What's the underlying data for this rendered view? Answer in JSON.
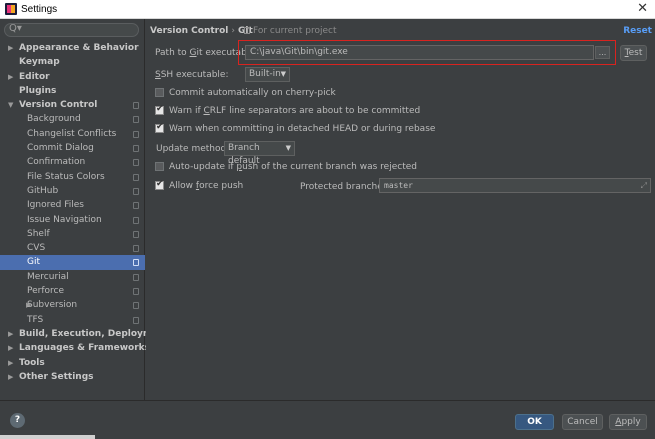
{
  "window": {
    "title": "Settings",
    "close_glyph": "✕"
  },
  "search": {
    "icon": "Q▾",
    "value": ""
  },
  "tree": [
    {
      "label": "Appearance & Behavior",
      "level": 0,
      "bold": true,
      "expander": "▶",
      "page_icon": false,
      "selected": false
    },
    {
      "label": "Keymap",
      "level": 0,
      "bold": true,
      "expander": "",
      "page_icon": false,
      "selected": false
    },
    {
      "label": "Editor",
      "level": 0,
      "bold": true,
      "expander": "▶",
      "page_icon": false,
      "selected": false
    },
    {
      "label": "Plugins",
      "level": 0,
      "bold": true,
      "expander": "",
      "page_icon": false,
      "selected": false
    },
    {
      "label": "Version Control",
      "level": 0,
      "bold": true,
      "expander": "▼",
      "page_icon": true,
      "selected": false
    },
    {
      "label": "Background",
      "level": 1,
      "bold": false,
      "expander": "",
      "page_icon": true,
      "selected": false
    },
    {
      "label": "Changelist Conflicts",
      "level": 1,
      "bold": false,
      "expander": "",
      "page_icon": true,
      "selected": false
    },
    {
      "label": "Commit Dialog",
      "level": 1,
      "bold": false,
      "expander": "",
      "page_icon": true,
      "selected": false
    },
    {
      "label": "Confirmation",
      "level": 1,
      "bold": false,
      "expander": "",
      "page_icon": true,
      "selected": false
    },
    {
      "label": "File Status Colors",
      "level": 1,
      "bold": false,
      "expander": "",
      "page_icon": true,
      "selected": false
    },
    {
      "label": "GitHub",
      "level": 1,
      "bold": false,
      "expander": "",
      "page_icon": true,
      "selected": false
    },
    {
      "label": "Ignored Files",
      "level": 1,
      "bold": false,
      "expander": "",
      "page_icon": true,
      "selected": false
    },
    {
      "label": "Issue Navigation",
      "level": 1,
      "bold": false,
      "expander": "",
      "page_icon": true,
      "selected": false
    },
    {
      "label": "Shelf",
      "level": 1,
      "bold": false,
      "expander": "",
      "page_icon": true,
      "selected": false
    },
    {
      "label": "CVS",
      "level": 1,
      "bold": false,
      "expander": "",
      "page_icon": true,
      "selected": false
    },
    {
      "label": "Git",
      "level": 1,
      "bold": false,
      "expander": "",
      "page_icon": true,
      "selected": true
    },
    {
      "label": "Mercurial",
      "level": 1,
      "bold": false,
      "expander": "",
      "page_icon": true,
      "selected": false
    },
    {
      "label": "Perforce",
      "level": 1,
      "bold": false,
      "expander": "",
      "page_icon": true,
      "selected": false
    },
    {
      "label": "Subversion",
      "level": 1,
      "bold": false,
      "expander": "▶",
      "page_icon": true,
      "selected": false
    },
    {
      "label": "TFS",
      "level": 1,
      "bold": false,
      "expander": "",
      "page_icon": true,
      "selected": false
    },
    {
      "label": "Build, Execution, Deployment",
      "level": 0,
      "bold": true,
      "expander": "▶",
      "page_icon": false,
      "selected": false
    },
    {
      "label": "Languages & Frameworks",
      "level": 0,
      "bold": true,
      "expander": "▶",
      "page_icon": false,
      "selected": false
    },
    {
      "label": "Tools",
      "level": 0,
      "bold": true,
      "expander": "▶",
      "page_icon": false,
      "selected": false
    },
    {
      "label": "Other Settings",
      "level": 0,
      "bold": true,
      "expander": "▶",
      "page_icon": false,
      "selected": false
    }
  ],
  "breadcrumb": {
    "parent": "Version Control",
    "separator": "›",
    "current": "Git"
  },
  "project_note": "For current project",
  "reset_label": "Reset",
  "git_path": {
    "label_before": "Path to ",
    "label_mnemonic": "G",
    "label_after": "it executable:",
    "value": "C:\\java\\Git\\bin\\git.exe",
    "browse_label": "...",
    "test_before": "",
    "test_mnemonic": "T",
    "test_after": "est"
  },
  "ssh": {
    "label_mnemonic": "S",
    "label_after": "SH executable:",
    "selected": "Built-in"
  },
  "options": {
    "commit_cherry_pick": {
      "checked": false,
      "before": "Commit automatically on cherry-pick",
      "mnemonic": "",
      "after": ""
    },
    "warn_crlf": {
      "checked": true,
      "before": "Warn if ",
      "mnemonic": "C",
      "after": "RLF line separators are about to be committed"
    },
    "warn_detached": {
      "checked": true,
      "before": "Warn when committing in detached HEAD or during rebase",
      "mnemonic": "",
      "after": ""
    },
    "auto_update": {
      "checked": false,
      "before": "Auto-update if ",
      "mnemonic": "p",
      "after": "ush of the current branch was rejected"
    },
    "allow_force_push": {
      "checked": true,
      "before": "Allow ",
      "mnemonic": "f",
      "after": "orce push"
    }
  },
  "update_method": {
    "label": "Update method:",
    "selected": "Branch default"
  },
  "protected_branches": {
    "label": "Protected branches:",
    "value": "master",
    "expand_icon": "⤢"
  },
  "footer": {
    "help": "?",
    "ok": "OK",
    "cancel": "Cancel",
    "apply_mnemonic": "A",
    "apply_after": "pply"
  },
  "colors": {
    "background": "#3c3f41",
    "selection": "#4b6eaf",
    "link": "#589df6",
    "highlight": "#d9231f",
    "primary_button": "#365880"
  }
}
